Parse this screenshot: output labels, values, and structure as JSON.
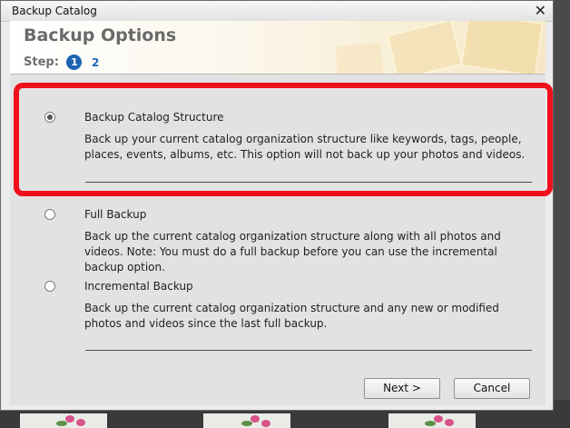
{
  "window": {
    "title": "Backup Catalog",
    "close_glyph": "✕"
  },
  "header": {
    "heading": "Backup Options",
    "step_label": "Step:",
    "steps": [
      "1",
      "2"
    ]
  },
  "options": [
    {
      "label": "Backup Catalog Structure",
      "description": "Back up your current catalog organization structure like keywords, tags, people, places, events, albums, etc. This option will not back up your photos and videos.",
      "selected": true
    },
    {
      "label": "Full Backup",
      "description": "Back up the current catalog organization structure along with all photos and videos. Note: You must do a full backup before you can use the incremental backup option.",
      "selected": false
    },
    {
      "label": "Incremental Backup",
      "description": "Back up the current catalog organization structure and any new or modified photos and videos since the last full backup.",
      "selected": false
    }
  ],
  "buttons": {
    "next": "Next >",
    "cancel": "Cancel"
  },
  "colors": {
    "highlight": "#f0101c",
    "step_active": "#1f64b3"
  }
}
